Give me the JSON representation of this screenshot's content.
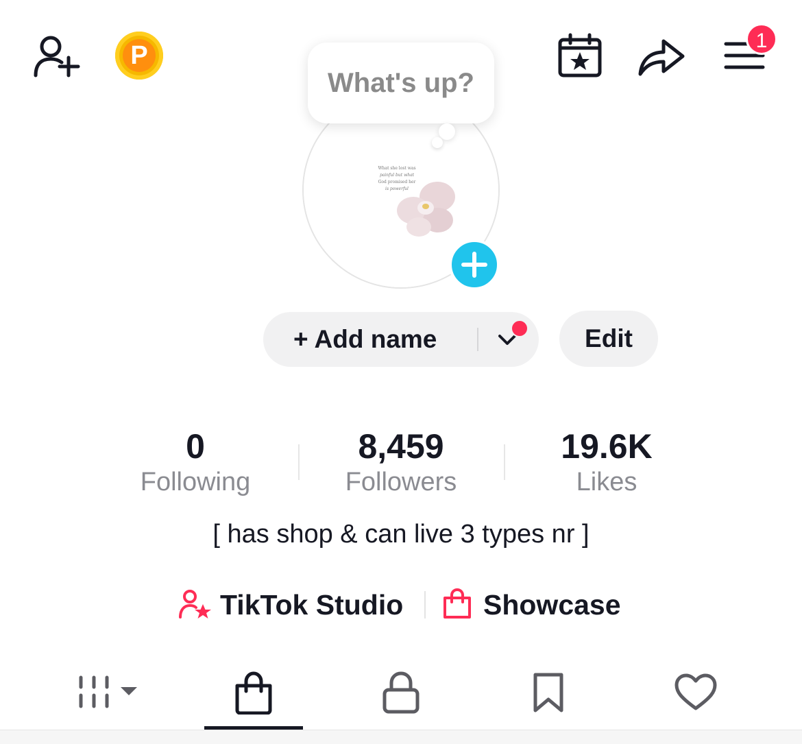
{
  "header": {
    "add_friend_icon": "person-add-icon",
    "coin_letter": "P",
    "calendar_icon": "calendar-star-icon",
    "share_icon": "share-arrow-icon",
    "menu_icon": "hamburger-menu-icon",
    "menu_badge": "1"
  },
  "avatar": {
    "bubble_text": "What's up?",
    "photo_caption_lines": [
      "What she lost was",
      "painful but what",
      "God promised her",
      "is powerful"
    ]
  },
  "profile": {
    "add_name_label": "+ Add name",
    "edit_label": "Edit"
  },
  "stats": [
    {
      "value": "0",
      "label": "Following"
    },
    {
      "value": "8,459",
      "label": "Followers"
    },
    {
      "value": "19.6K",
      "label": "Likes"
    }
  ],
  "bio": "[ has shop & can live 3 types nr ]",
  "links": {
    "studio_label": "TikTok Studio",
    "showcase_label": "Showcase"
  },
  "tabs": [
    {
      "icon": "grid-icon",
      "active": false
    },
    {
      "icon": "shopping-bag-icon",
      "active": true
    },
    {
      "icon": "lock-icon",
      "active": false
    },
    {
      "icon": "bookmark-icon",
      "active": false
    },
    {
      "icon": "heart-icon",
      "active": false
    }
  ],
  "colors": {
    "accent_red": "#fe2c55",
    "accent_cyan": "#20c4ec",
    "coin_gold": "#f6b800",
    "text_primary": "#161823",
    "text_secondary": "#8a8b91"
  }
}
